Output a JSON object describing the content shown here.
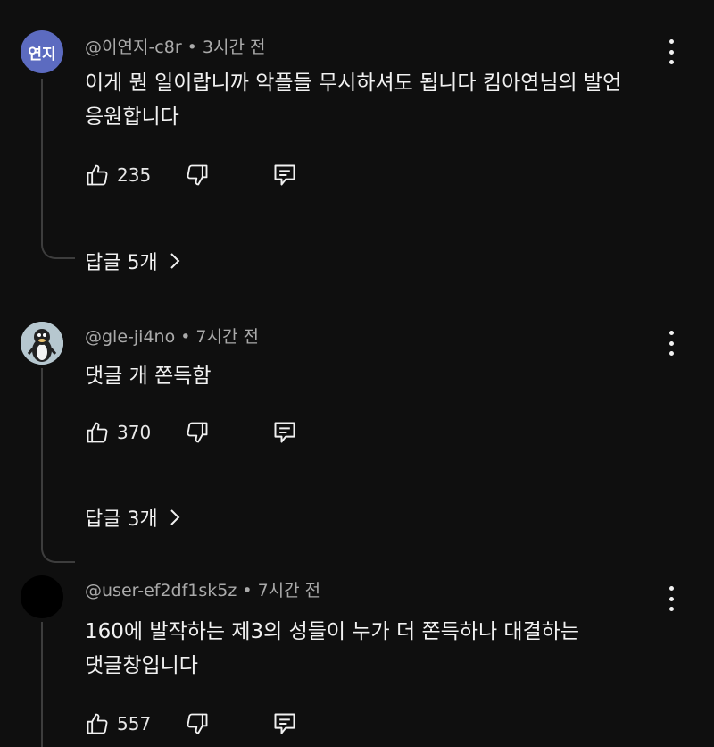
{
  "comments": [
    {
      "avatar_text": "연지",
      "author": "@이연지-c8r",
      "time": "3시간 전",
      "text_lines": [
        "이게 뭔 일이랍니까 악플들 무시하셔도 됩니다 킴아연님의 발언",
        "응원합니다"
      ],
      "likes": "235",
      "replies_label": "답글 5개"
    },
    {
      "avatar_icon": "penguin-avatar",
      "author": "@gle-ji4no",
      "time": "7시간 전",
      "text_lines": [
        "댓글 개 쫀득함"
      ],
      "likes": "370",
      "replies_label": "답글 3개"
    },
    {
      "avatar_icon": "black-avatar",
      "author": "@user-ef2df1sk5z",
      "time": "7시간 전",
      "text_lines": [
        "160에 발작하는 제3의 성들이 누가 더 쫀득하나 대결하는",
        "댓글창입니다"
      ],
      "likes": "557"
    }
  ],
  "icons": {
    "like": "thumbs-up-icon",
    "dislike": "thumbs-down-icon",
    "reply": "comment-reply-icon",
    "more": "more-vert-icon",
    "chevron": "chevron-right-icon"
  },
  "colors": {
    "background": "#0f0f0f",
    "text": "#f1f1f1",
    "meta": "#aaaaaa",
    "avatar_badge": "#5c6bc0"
  }
}
